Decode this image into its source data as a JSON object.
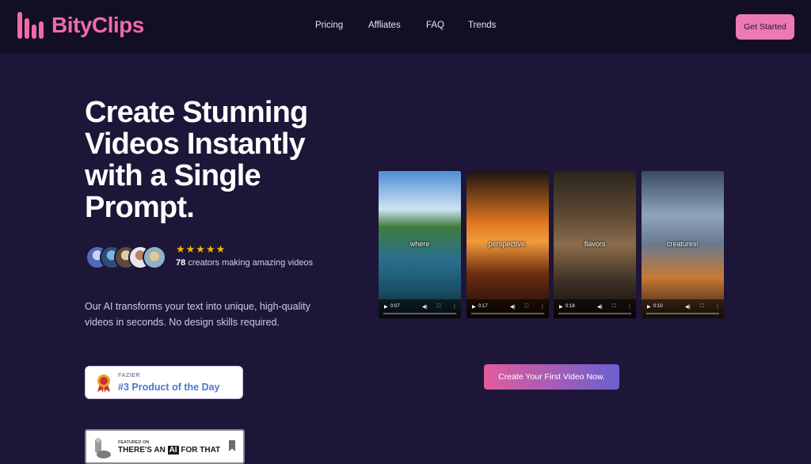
{
  "brand": {
    "name": "BityClips",
    "accent": "#f06aa6"
  },
  "nav": {
    "items": [
      "Pricing",
      "Affliates",
      "FAQ",
      "Trends"
    ]
  },
  "header": {
    "cta_label": "Get Started"
  },
  "hero": {
    "title": "Create Stunning Videos Instantly with a Single Prompt.",
    "rating_stars": "★★★★★",
    "creators_count": "78",
    "creators_text": "creators making amazing videos",
    "description": "Our AI transforms your text into unique, high-quality videos in seconds. No design skills required."
  },
  "badges": {
    "fazier_small": "FAZIER",
    "fazier_big": "#3 Product of the Day",
    "featured_small": "FEATURED ON",
    "featured_pre": "THERE'S AN ",
    "featured_ai": "AI",
    "featured_post": " FOR THAT"
  },
  "videos": [
    {
      "caption": "where",
      "time": "0:07"
    },
    {
      "caption": "perspective.",
      "time": "0:17"
    },
    {
      "caption": "flavors",
      "time": "0:18"
    },
    {
      "caption": "creatures!",
      "time": "0:10"
    }
  ],
  "main_cta": {
    "label": "Create Your First Video Now."
  }
}
